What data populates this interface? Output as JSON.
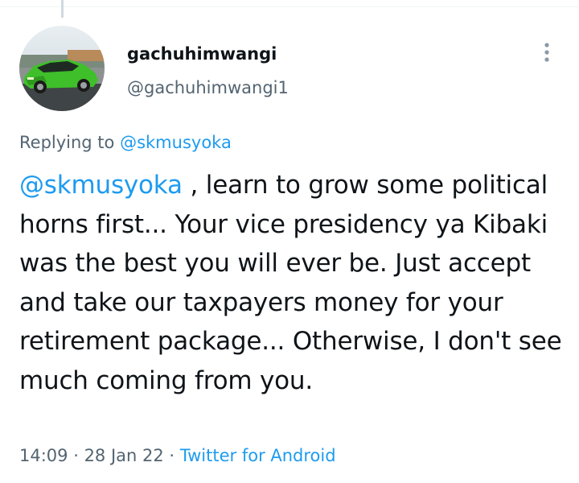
{
  "tweet": {
    "display_name": "gachuhimwangi",
    "handle": "@gachuhimwangi1",
    "replying_prefix": "Replying to ",
    "replying_to": "@skmusyoka",
    "text_mention": "@skmusyoka",
    "text_body": " , learn to grow some political horns first... Your vice presidency ya Kibaki was the best you will ever be. Just accept and take our taxpayers money for your retirement package... Otherwise, I don't see much coming from you.",
    "time": "14:09",
    "separator": " · ",
    "date": "28 Jan 22",
    "source": "Twitter for Android"
  },
  "icons": {
    "more": "more-vertical-icon",
    "avatar": "green-car-avatar"
  },
  "colors": {
    "link": "#1d9bf0",
    "secondary_text": "#536471",
    "primary_text": "#0f1419"
  }
}
